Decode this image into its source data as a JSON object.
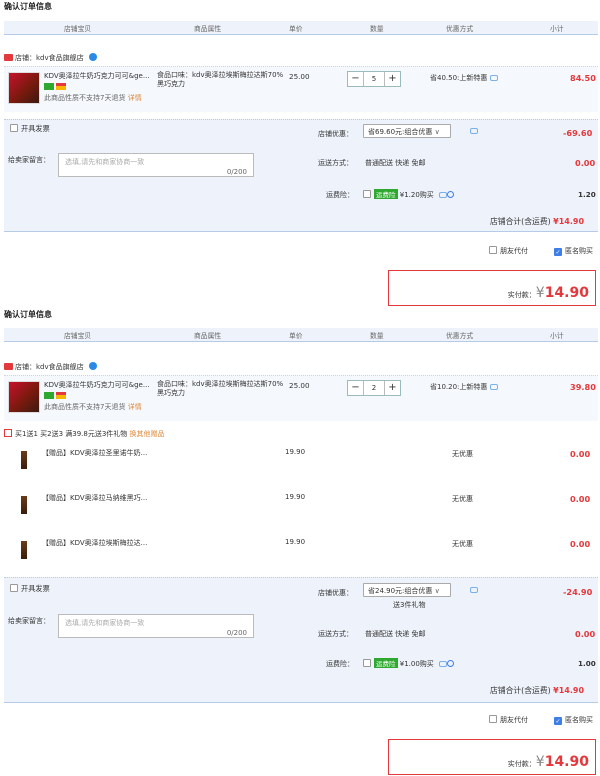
{
  "headers": [
    "店铺宝贝",
    "商品属性",
    "单价",
    "数量",
    "优惠方式",
    "小计"
  ],
  "section1": {
    "title": "确认订单信息",
    "shop_name": "店铺：kdv食品旗舰店",
    "item": {
      "name": "KDV奥泽拉牛奶巧克力可可&ge...",
      "attr": "食品口味：kdv奥泽拉埃斯梅拉达斯70%黑巧克力",
      "note": "此商品性质不支持7天退货",
      "detail": "详情",
      "price": "25.00",
      "qty": "5",
      "discount": "省40.50:上新特惠",
      "subtotal": "84.50"
    },
    "invoice": "开具发票",
    "shop_discount_label": "店铺优惠：",
    "shop_discount_value": "省69.60元:组合优惠",
    "shop_discount_amount": "-69.60",
    "message_label": "给卖家留言：",
    "message_placeholder": "选填,请先和商家协商一致",
    "message_count": "0/200",
    "shipping_label": "运送方式：",
    "shipping_value": "普通配送 快递 免邮",
    "shipping_amount": "0.00",
    "insurance_label": "运费险：",
    "insurance_tag": "运费险",
    "insurance_text": "¥1.20购买",
    "insurance_amount": "1.20",
    "shop_total_label": "店铺合计(含运费)",
    "shop_total_value": "¥14.90",
    "friend_pay": "朋友代付",
    "anon_buy": "匿名购买",
    "pay_label": "实付款：",
    "pay_currency": "¥",
    "pay_value": "14.90"
  },
  "section2": {
    "title": "确认订单信息",
    "shop_name": "店铺：kdv食品旗舰店",
    "item": {
      "name": "KDV奥泽拉牛奶巧克力可可&ge...",
      "attr": "食品口味：kdv奥泽拉埃斯梅拉达斯70%黑巧克力",
      "note": "此商品性质不支持7天退货",
      "detail": "详情",
      "price": "25.00",
      "qty": "2",
      "discount": "省10.20:上新特惠",
      "subtotal": "39.80"
    },
    "promo_text": "买1送1 买2送3  满39.8元送3件礼物",
    "promo_link": "换其他赠品",
    "gifts": [
      {
        "name": "【赠品】KDV奥泽拉圣里诺牛奶...",
        "price": "19.90",
        "discount": "无优惠",
        "subtotal": "0.00"
      },
      {
        "name": "【赠品】KDV奥泽拉马纳维黑巧...",
        "price": "19.90",
        "discount": "无优惠",
        "subtotal": "0.00"
      },
      {
        "name": "【赠品】KDV奥泽拉埃斯梅拉达...",
        "price": "19.90",
        "discount": "无优惠",
        "subtotal": "0.00"
      }
    ],
    "invoice": "开具发票",
    "shop_discount_label": "店铺优惠：",
    "shop_discount_value": "省24.90元:组合优惠",
    "shop_discount_sub": "送3件礼物",
    "shop_discount_amount": "-24.90",
    "message_label": "给卖家留言：",
    "message_placeholder": "选填,请先和商家协商一致",
    "message_count": "0/200",
    "shipping_label": "运送方式：",
    "shipping_value": "普通配送 快递 免邮",
    "shipping_amount": "0.00",
    "insurance_label": "运费险：",
    "insurance_tag": "运费险",
    "insurance_text": "¥1.00购买",
    "insurance_amount": "1.00",
    "shop_total_label": "店铺合计(含运费)",
    "shop_total_value": "¥14.90",
    "friend_pay": "朋友代付",
    "anon_buy": "匿名购买",
    "pay_label": "实付款：",
    "pay_currency": "¥",
    "pay_value": "14.90"
  }
}
